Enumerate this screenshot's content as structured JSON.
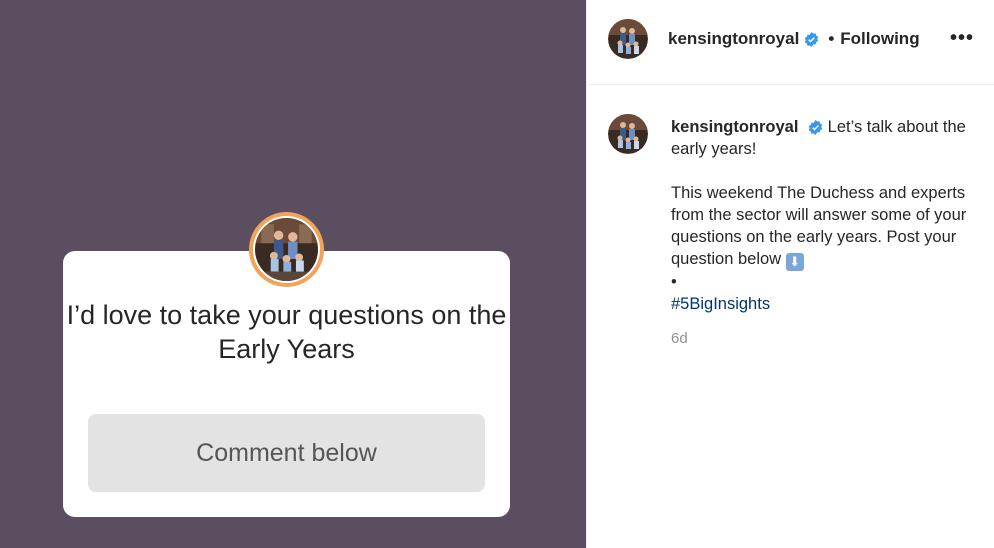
{
  "story": {
    "question_text": "I’d love to take your questions on the Early Years",
    "button_label": "Comment below"
  },
  "header": {
    "username": "kensingtonroyal",
    "separator": "•",
    "follow_status": "Following",
    "more_icon": "more-horizontal-icon"
  },
  "post": {
    "username": "kensingtonroyal",
    "caption_line1": "Let’s talk about the early years!",
    "caption_line2": "This weekend The Duchess and experts from the sector will answer some of your questions on the early years. Post your question below",
    "arrow_emoji": "⬇",
    "bullet": "•",
    "hashtag": "#5BigInsights",
    "timestamp": "6d"
  },
  "colors": {
    "media_background": "#5b4e60",
    "avatar_ring": "#f0a35a",
    "verified_badge": "#3897f0",
    "hashtag": "#00376b"
  }
}
